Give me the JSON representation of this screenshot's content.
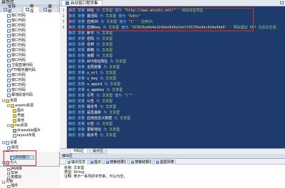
{
  "left_panel": {
    "title": "属性区",
    "tabs": [
      {
        "label": "支持库",
        "icon": "library-icon"
      },
      {
        "label": "程序",
        "icon": "program-icon"
      },
      {
        "label": "属性",
        "icon": "properties-icon"
      }
    ],
    "tree": [
      "窗口代码",
      "窗口代码",
      "窗口代码",
      "窗口代码",
      "窗口代码",
      "窗口代码",
      "窗口代码",
      "窗口代码",
      "窗口代码",
      "窗口代码",
      "卫视直播代码",
      "FTP服务器代码",
      "窗口代码",
      "窗口代码",
      "窗口代码",
      "窗口代码",
      "幕墙段落代码",
      "资源",
      "assets资源",
      "图片",
      "界面",
      "其他",
      "res资源",
      "drawable图片",
      "layout布局",
      "设置",
      "属性",
      "模块",
      "启动窗口",
      "引入"
    ],
    "bottom": [
      "JAVA库",
      "SDK",
      "类模块",
      "文档",
      "插件",
      "全局变量",
      "常量资源"
    ]
  },
  "editor": {
    "tab_label": "启动窗口程序集",
    "code_tabs": [
      "代码区",
      "设计区"
    ],
    "lines": [
      {
        "kw": "变量",
        "name": "网址",
        "type": "文本型",
        "val": "\"http://www.ahzybc.net/\"",
        "comment": "网站验证地址"
      },
      {
        "kw": "变量",
        "name": "激活码",
        "type": "文本型",
        "val": "\"kdns\"",
        "comment": ""
      },
      {
        "kw": "变量",
        "name": "应用ID",
        "type": "文本型",
        "val": "\"1\"",
        "comment": "应用ID"
      },
      {
        "kw": "变量",
        "name": "应用key",
        "type": "文本型",
        "val": "\"3C963ba6b4e1b4bbe6d9e2eb1fd570be4ec6d4a4dd6\"",
        "comment": "网站验证 KEY 在后台生成"
      },
      {
        "kw": "变量",
        "name": "账号",
        "type": "文本型",
        "val": "",
        "comment": ""
      },
      {
        "kw": "变量",
        "name": "密码",
        "type": "文本型",
        "val": "",
        "comment": ""
      },
      {
        "kw": "变量",
        "name": "名称",
        "type": "文本型",
        "val": "",
        "comment": ""
      },
      {
        "kw": "变量",
        "name": "邮箱",
        "type": "文本型",
        "val": "",
        "comment": ""
      },
      {
        "kw": "变量",
        "name": "余额",
        "type": "文本型",
        "val": "",
        "comment": ""
      },
      {
        "kw": "变量",
        "name": "API地址网址",
        "type": "文本型",
        "val": "",
        "comment": ""
      },
      {
        "kw": "变量",
        "name": "全局变量",
        "type": "文本型",
        "val": "",
        "comment": ""
      },
      {
        "kw": "变量",
        "name": "u_url",
        "type": "文本型",
        "val": "",
        "comment": ""
      },
      {
        "kw": "变量",
        "name": "u_key",
        "type": "文本型",
        "val": "",
        "comment": ""
      },
      {
        "kw": "变量",
        "name": "u_appid",
        "type": "文本型",
        "val": "",
        "comment": ""
      },
      {
        "kw": "变量",
        "name": "u_appkey",
        "type": "文本型",
        "val": "",
        "comment": ""
      },
      {
        "kw": "变量",
        "name": "引号",
        "type": "文本型",
        "val": "\"\\\"\"",
        "comment": ""
      },
      {
        "kw": "变量",
        "name": "公告",
        "type": "文本型",
        "val": "",
        "comment": ""
      },
      {
        "kw": "变量",
        "name": "版本号",
        "type": "文本型",
        "val": "",
        "comment": ""
      },
      {
        "kw": "变量",
        "name": "是否最新",
        "type": "文本型",
        "val": "",
        "comment": ""
      },
      {
        "kw": "变量",
        "name": "应用自定义数据",
        "type": "文本型",
        "val": "",
        "comment": ""
      },
      {
        "kw": "变量",
        "name": "公告",
        "type": "文本型",
        "val": "",
        "comment": ""
      },
      {
        "kw": "变量",
        "name": "更新地址",
        "type": "文本型",
        "val": "",
        "comment": ""
      },
      {
        "kw": "变量",
        "name": "版本号",
        "type": "文本型",
        "val": "",
        "comment": ""
      }
    ],
    "line_numbers": [
      "1",
      "2",
      "3",
      "4"
    ],
    "keyword_prefix": "静态",
    "type_word": "为",
    "assign_word": "值为"
  },
  "output": {
    "title": "输出区",
    "tabs": [
      "输出信息",
      "提示",
      "搜索结果1",
      "搜索结果2",
      "监视列表"
    ],
    "lines": [
      "名称: 文本型",
      "类型: String",
      "注释: 表示一系列的字符串，可以为空。"
    ]
  }
}
